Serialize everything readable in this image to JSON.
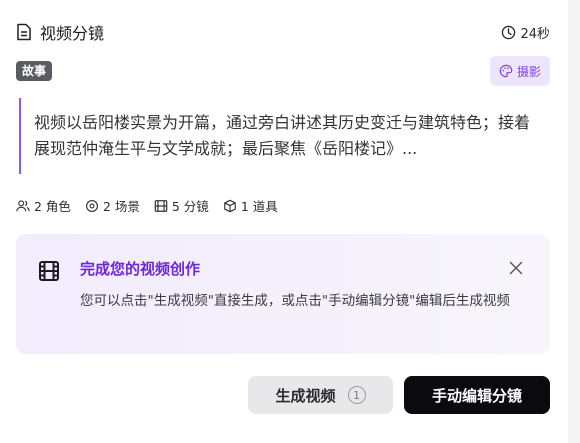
{
  "header": {
    "title": "视频分镜",
    "duration": "24秒",
    "doc_icon": "document-icon",
    "clock_icon": "clock-icon"
  },
  "tags": {
    "category": "故事",
    "style": "摄影",
    "style_icon": "palette-icon"
  },
  "summary": "视频以岳阳楼实景为开篇，通过旁白讲述其历史变迁与建筑特色；接着展现范仲淹生平与文学成就；最后聚焦《岳阳楼记》...",
  "stats": [
    {
      "icon": "people-icon",
      "label": "2 角色"
    },
    {
      "icon": "location-icon",
      "label": "2 场景"
    },
    {
      "icon": "film-icon",
      "label": "5 分镜"
    },
    {
      "icon": "box-icon",
      "label": "1 道具"
    }
  ],
  "notice": {
    "title": "完成您的视频创作",
    "text": "您可以点击\"生成视频\"直接生成，或点击\"手动编辑分镜\"编辑后生成视频",
    "icon": "film-icon",
    "close_icon": "close-icon"
  },
  "actions": {
    "generate_label": "生成视频",
    "generate_count": "1",
    "manual_label": "手动编辑分镜"
  },
  "colors": {
    "accent": "#7b3fe4",
    "primary_button": "#0b0b0f"
  }
}
